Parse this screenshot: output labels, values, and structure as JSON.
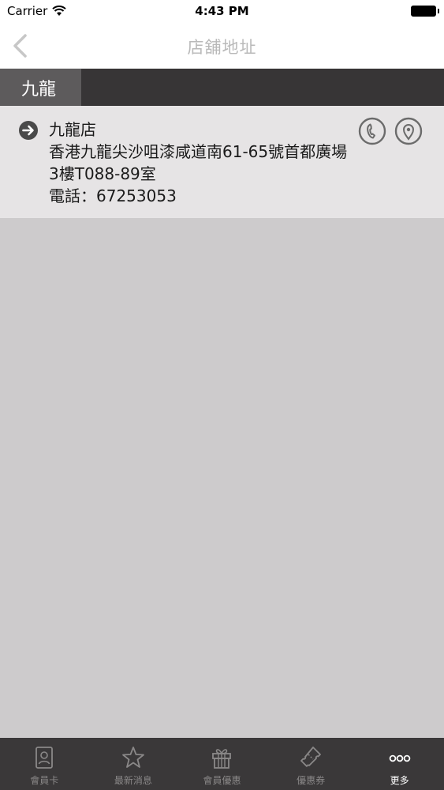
{
  "status_bar": {
    "carrier": "Carrier",
    "time": "4:43 PM"
  },
  "nav": {
    "title": "店舖地址"
  },
  "regions": [
    {
      "label": "九龍"
    }
  ],
  "stores": [
    {
      "name": "九龍店",
      "address": "香港九龍尖沙咀漆咸道南61-65號首都廣場3樓T088-89室",
      "phone": "電話：67253053"
    }
  ],
  "tabs": [
    {
      "label": "會員卡",
      "icon": "member-card-icon"
    },
    {
      "label": "最新消息",
      "icon": "star-icon"
    },
    {
      "label": "會員優惠",
      "icon": "gift-icon"
    },
    {
      "label": "優惠券",
      "icon": "coupon-icon"
    },
    {
      "label": "更多",
      "icon": "more-icon"
    }
  ],
  "colors": {
    "tab_bar_bg": "#3a3839",
    "region_bar_bg": "#373536",
    "region_tab_active": "#5d5b5c",
    "content_bg": "#cdcbcc",
    "store_row_bg": "#e6e4e5",
    "icon_gray": "#6b6b6b"
  }
}
